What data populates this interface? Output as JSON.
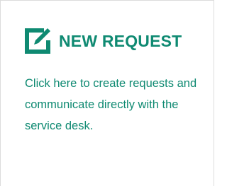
{
  "card": {
    "title": "NEW REQUEST",
    "description": "Click here to create requests and communicate directly with the service desk.",
    "icon": "edit-icon",
    "accent_color": "#0f8a72"
  }
}
